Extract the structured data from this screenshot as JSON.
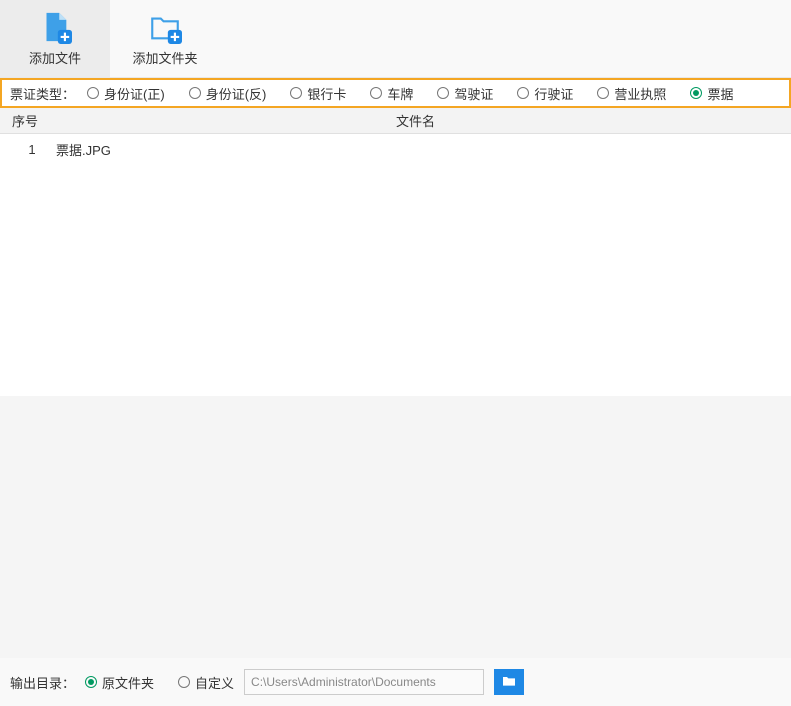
{
  "toolbar": {
    "addFile": "添加文件",
    "addFolder": "添加文件夹"
  },
  "typeRow": {
    "label": "票证类型：",
    "options": [
      {
        "label": "身份证(正)",
        "checked": false
      },
      {
        "label": "身份证(反)",
        "checked": false
      },
      {
        "label": "银行卡",
        "checked": false
      },
      {
        "label": "车牌",
        "checked": false
      },
      {
        "label": "驾驶证",
        "checked": false
      },
      {
        "label": "行驶证",
        "checked": false
      },
      {
        "label": "营业执照",
        "checked": false
      },
      {
        "label": "票据",
        "checked": true
      }
    ]
  },
  "columns": {
    "index": "序号",
    "filename": "文件名"
  },
  "files": [
    {
      "index": "1",
      "name": "票据.JPG"
    }
  ],
  "output": {
    "label": "输出目录：",
    "options": [
      {
        "label": "原文件夹",
        "checked": true
      },
      {
        "label": "自定义",
        "checked": false
      }
    ],
    "path": "C:\\Users\\Administrator\\Documents"
  }
}
